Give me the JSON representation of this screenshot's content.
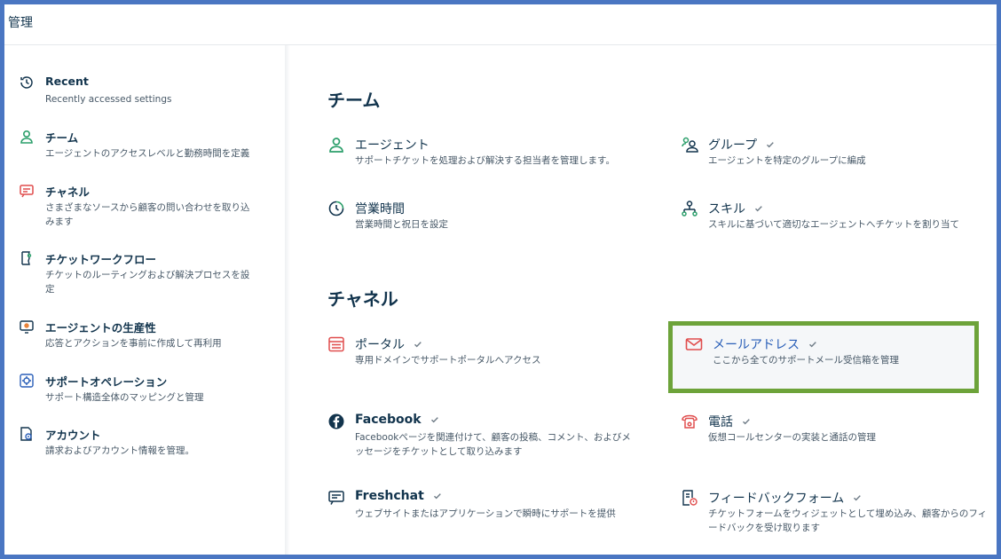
{
  "topbar": {
    "title": "管理"
  },
  "sidebar": {
    "items": [
      {
        "icon": "clock-icon",
        "title": "Recent",
        "desc": "Recently accessed settings"
      },
      {
        "icon": "person-icon",
        "title": "チーム",
        "desc": "エージェントのアクセスレベルと勤務時間を定義"
      },
      {
        "icon": "channel-icon",
        "title": "チャネル",
        "desc": "さまざまなソースから顧客の問い合わせを取り込みます"
      },
      {
        "icon": "workflow-icon",
        "title": "チケットワークフロー",
        "desc": "チケットのルーティングおよび解決プロセスを設定"
      },
      {
        "icon": "productivity-icon",
        "title": "エージェントの生産性",
        "desc": "応答とアクションを事前に作成して再利用"
      },
      {
        "icon": "operations-icon",
        "title": "サポートオペレーション",
        "desc": "サポート構造全体のマッピングと管理"
      },
      {
        "icon": "account-icon",
        "title": "アカウント",
        "desc": "請求およびアカウント情報を管理。"
      }
    ]
  },
  "team": {
    "title": "チーム",
    "cards": [
      {
        "title": "エージェント",
        "desc": "サポートチケットを処理および解決する担当者を管理します。"
      },
      {
        "title": "グループ",
        "desc": "エージェントを特定のグループに編成"
      },
      {
        "title": "営業時間",
        "desc": "営業時間と祝日を設定"
      },
      {
        "title": "スキル",
        "desc": "スキルに基づいて適切なエージェントへチケットを割り当て"
      }
    ]
  },
  "channel": {
    "title": "チャネル",
    "cards": [
      {
        "title": "ポータル",
        "desc": "専用ドメインでサポートポータルへアクセス"
      },
      {
        "title": "メールアドレス",
        "desc": "ここから全てのサポートメール受信箱を管理"
      },
      {
        "title": "Facebook",
        "desc": "Facebookページを関連付けて、顧客の投稿、コメント、およびメッセージをチケットとして取り込みます"
      },
      {
        "title": "電話",
        "desc": "仮想コールセンターの実装と通話の管理"
      },
      {
        "title": "Freshchat",
        "desc": "ウェブサイトまたはアプリケーションで瞬時にサポートを提供"
      },
      {
        "title": "フィードバックフォーム",
        "desc": "チケットフォームをウィジェットとして埋め込み、顧客からのフィードバックを受け取ります"
      }
    ]
  },
  "colors": {
    "highlight": "#6da33a",
    "accent_green": "#2c9f6b",
    "accent_red": "#e04d4d",
    "frame_border": "#4a76c2"
  }
}
